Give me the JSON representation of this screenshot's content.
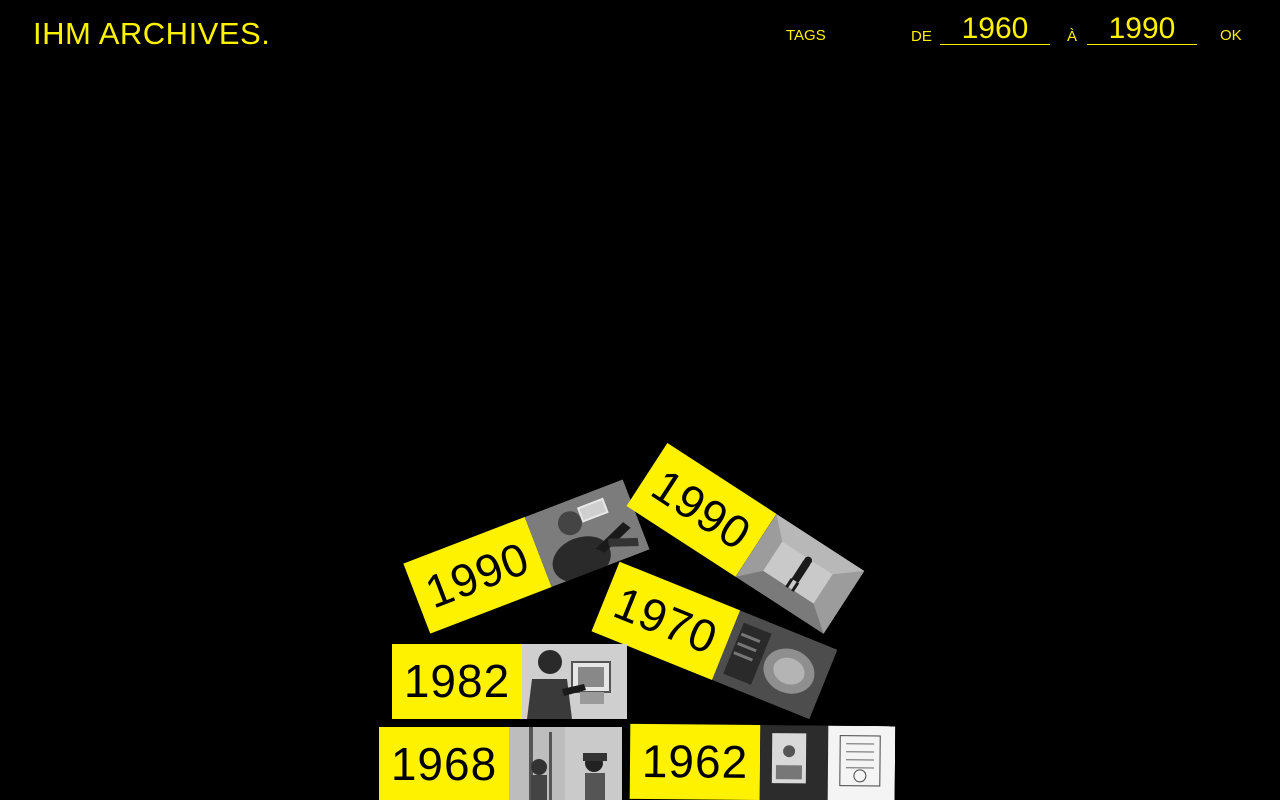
{
  "header": {
    "logo": "IHM ARCHIVES.",
    "tags_label": "TAGS",
    "from_label": "DE",
    "from_value": "1960",
    "to_label": "À",
    "to_value": "1990",
    "ok_label": "OK"
  },
  "colors": {
    "accent": "#fff200",
    "background": "#000000"
  },
  "cards": [
    {
      "year": "1990",
      "photo": "person-with-vr-headset-photo"
    },
    {
      "year": "1990",
      "photo": "person-in-room-photo"
    },
    {
      "year": "1970",
      "photo": "machine-device-photo"
    },
    {
      "year": "1982",
      "photo": "person-at-computer-photo"
    },
    {
      "year": "1968",
      "photo": "head-mounted-display-photo"
    },
    {
      "year": "1962",
      "photo": "sensorama-machine-photo"
    }
  ]
}
